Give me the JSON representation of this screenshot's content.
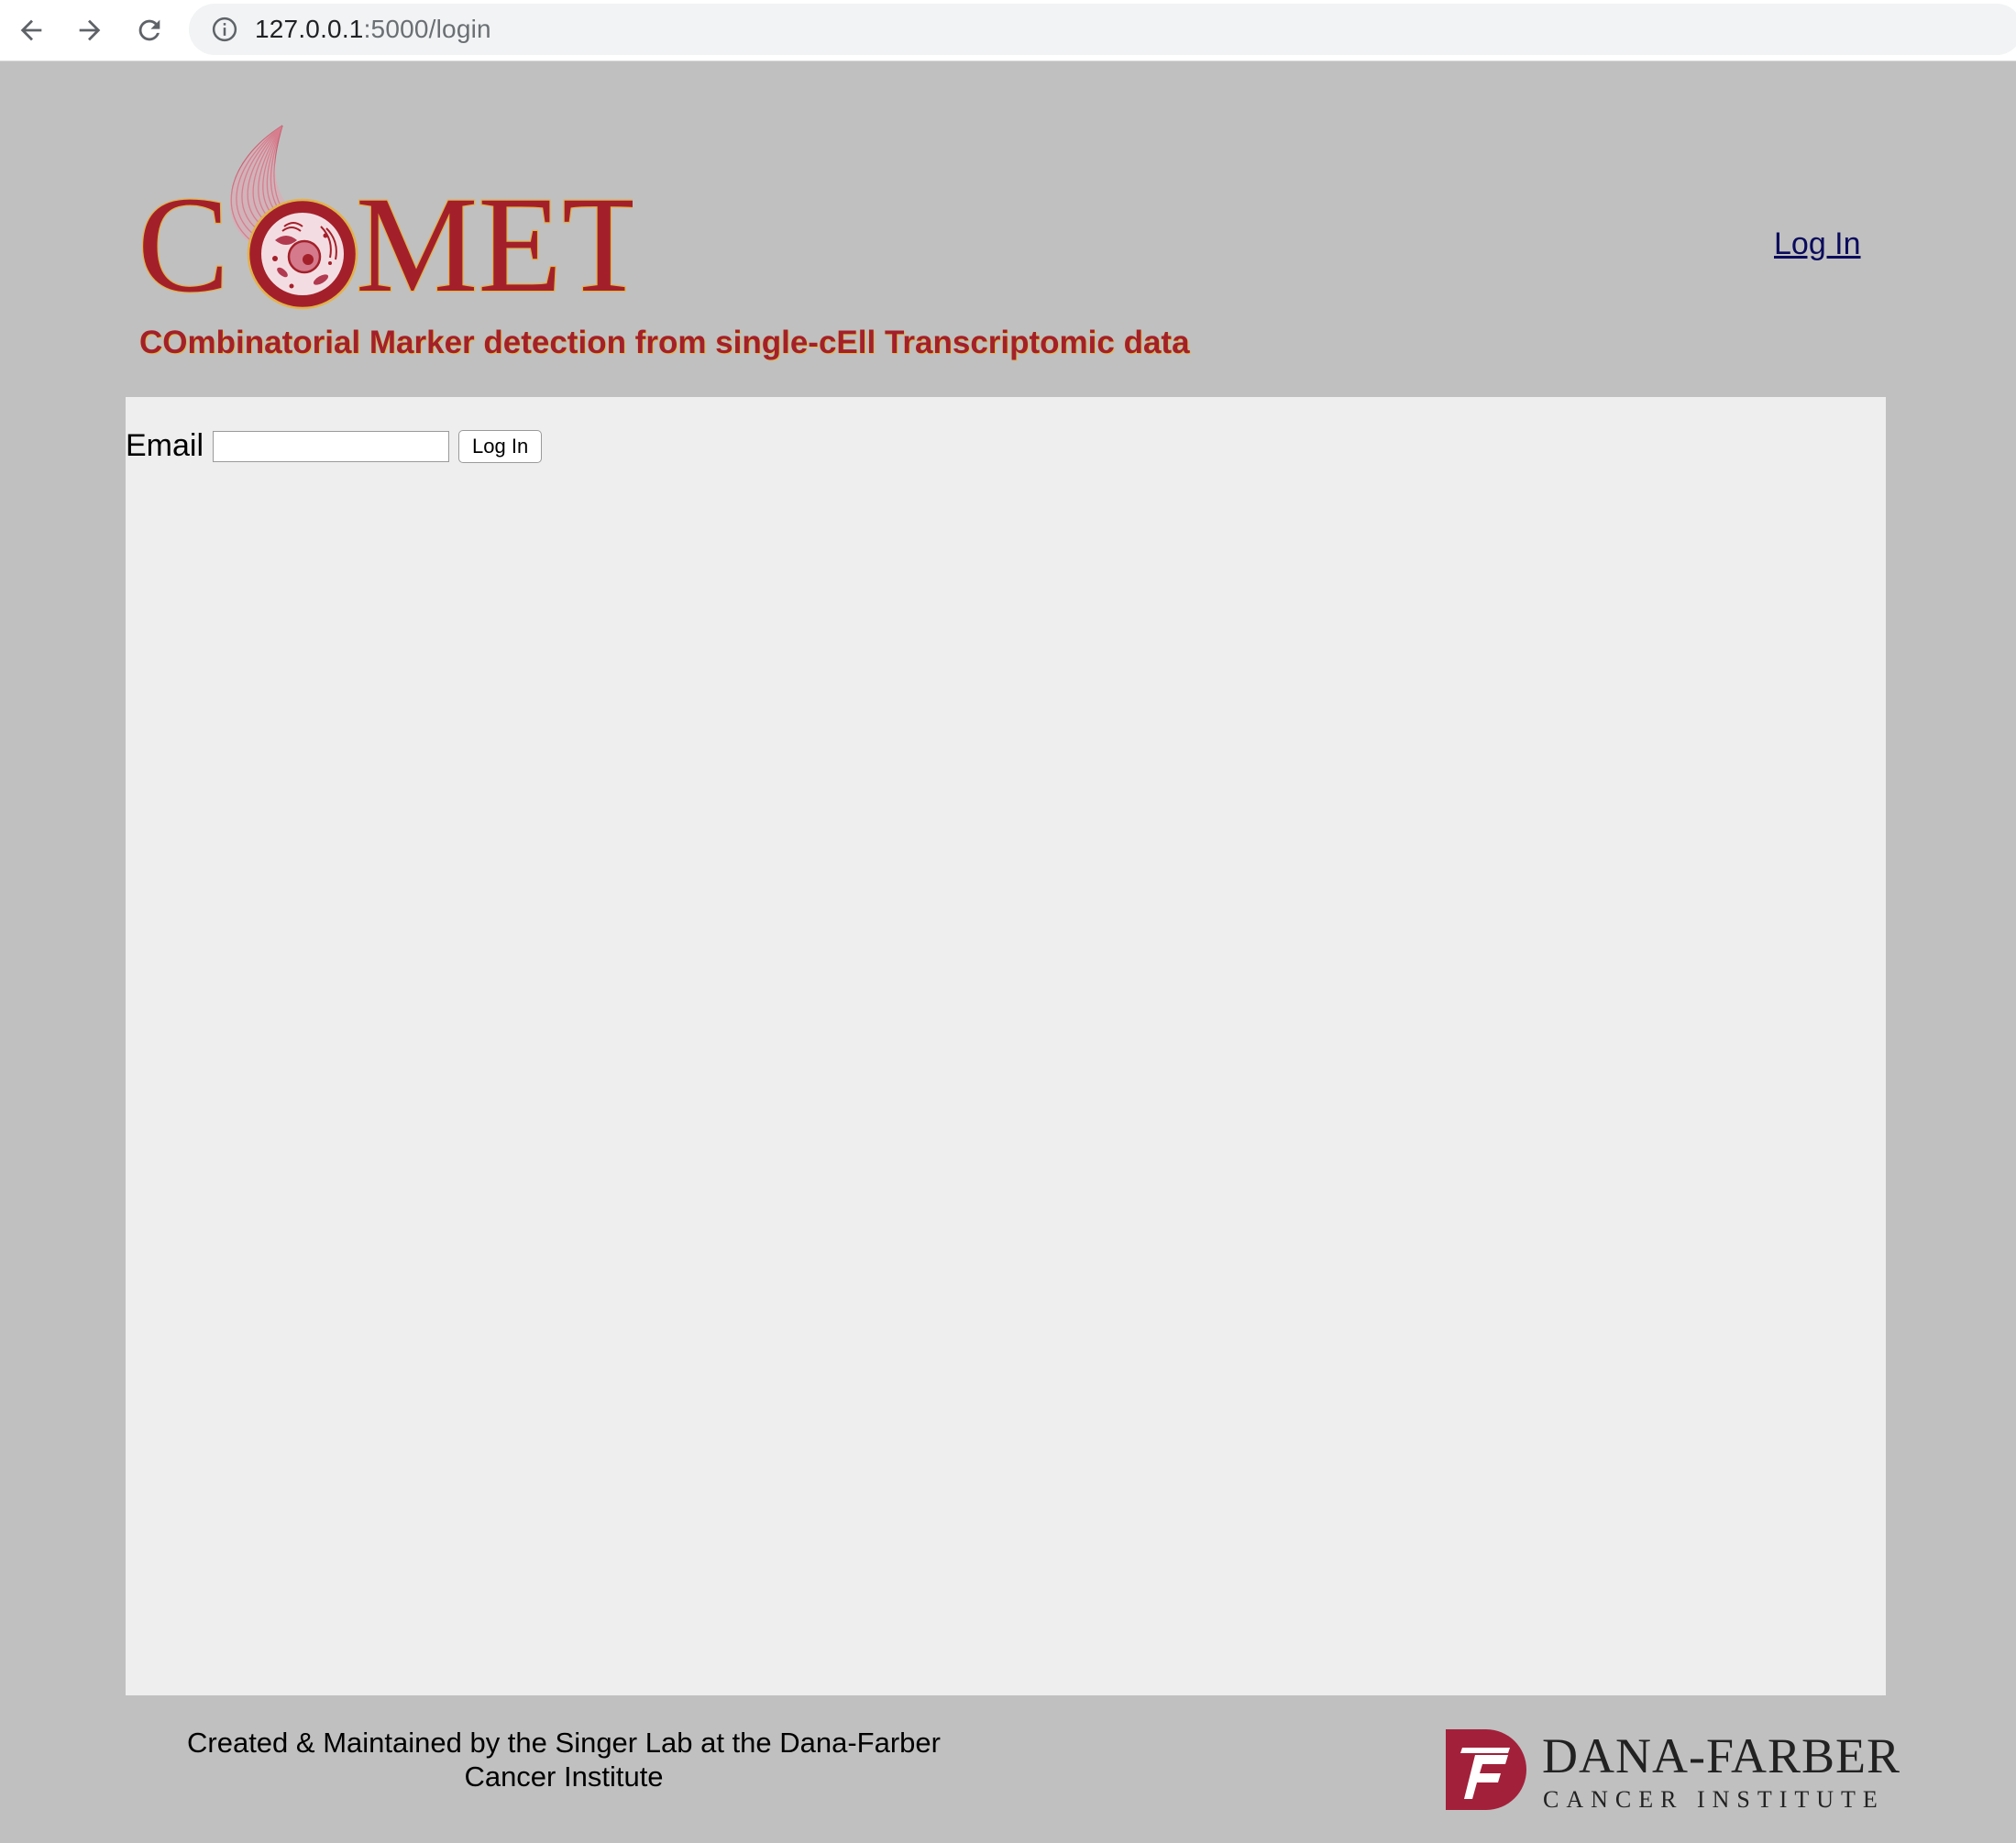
{
  "browser": {
    "url_host": "127.0.0.1",
    "url_rest": ":5000/login"
  },
  "header": {
    "logo_text": "COMET",
    "login_link": "Log In",
    "tagline": "COmbinatorial Marker detection from single-cEll Transcriptomic data"
  },
  "login_form": {
    "email_label": "Email",
    "email_value": "",
    "email_placeholder": "",
    "submit_label": "Log In"
  },
  "footer": {
    "credit_line1": "Created & Maintained by the Singer Lab at the Dana-Farber",
    "credit_line2": "Cancer Institute",
    "institute_name": "DANA-FARBER",
    "institute_sub": "CANCER INSTITUTE"
  },
  "colors": {
    "page_bg": "#c0c0c0",
    "panel_bg": "#eeeeee",
    "brand_red": "#a3202a",
    "link": "#0b0b5c"
  }
}
